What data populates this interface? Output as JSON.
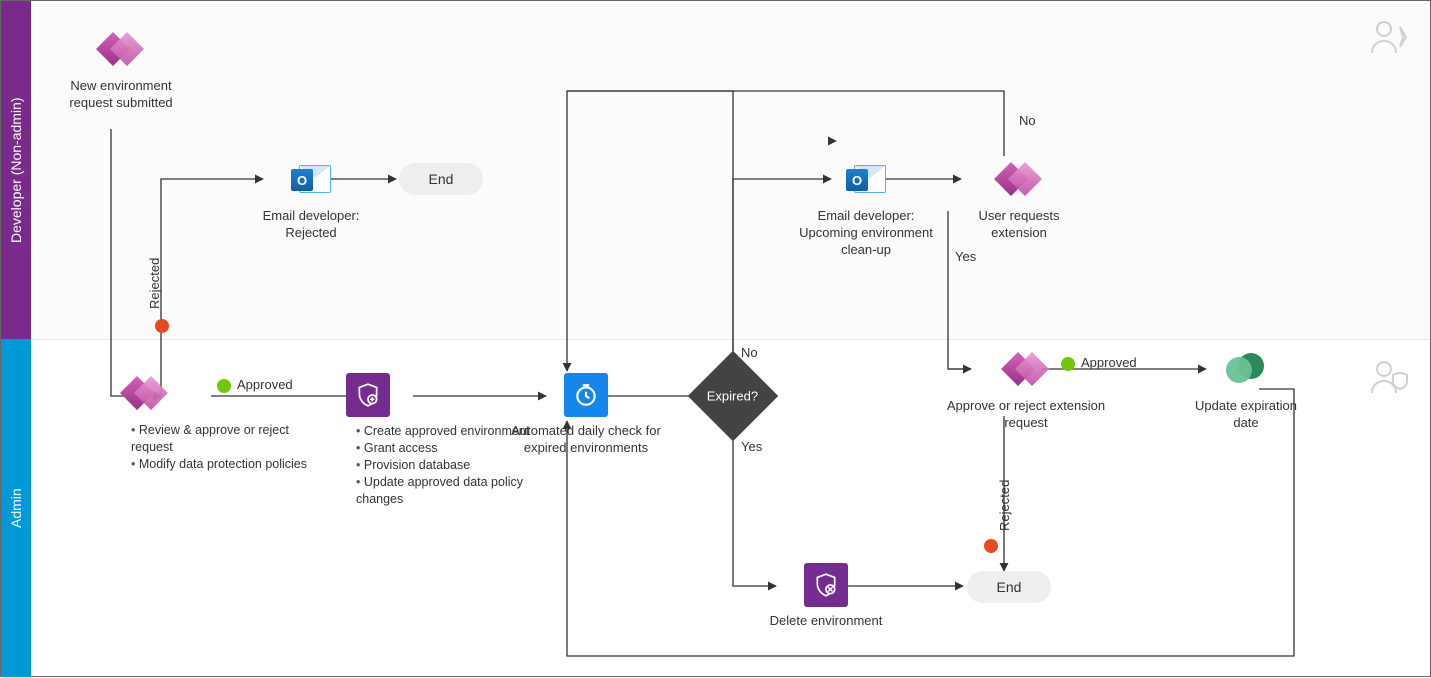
{
  "lanes": {
    "developer": "Developer (Non-admin)",
    "admin": "Admin"
  },
  "nodes": {
    "new_request": "New environment request submitted",
    "email_rejected": "Email developer:\nRejected",
    "end1": "End",
    "review": {
      "bullets": [
        "Review & approve or reject request",
        "Modify data protection policies"
      ]
    },
    "create_env": {
      "bullets": [
        "Create approved environment",
        "Grant access",
        "Provision database",
        "Update approved data policy changes"
      ]
    },
    "daily_check": "Automated daily check for expired environments",
    "expired_q": "Expired?",
    "email_cleanup": "Email developer:\nUpcoming environment clean-up",
    "user_ext": "User requests extension",
    "approve_ext": "Approve or reject extension request",
    "update_exp": "Update expiration date",
    "delete_env": "Delete environment",
    "end2": "End"
  },
  "edges": {
    "rejected": "Rejected",
    "approved": "Approved",
    "expired_yes": "Yes",
    "expired_no": "No",
    "ext_yes": "Yes",
    "ext_no": "No",
    "ext_approved": "Approved",
    "ext_rejected": "Rejected"
  },
  "colors": {
    "lane_dev": "#7a2a8a",
    "lane_admin": "#0099d8",
    "accent_power": "#9a2d86",
    "accent_shield": "#742c91",
    "accent_automate": "#1586ee",
    "status_green": "#71c80a",
    "status_red": "#e64b1f"
  }
}
